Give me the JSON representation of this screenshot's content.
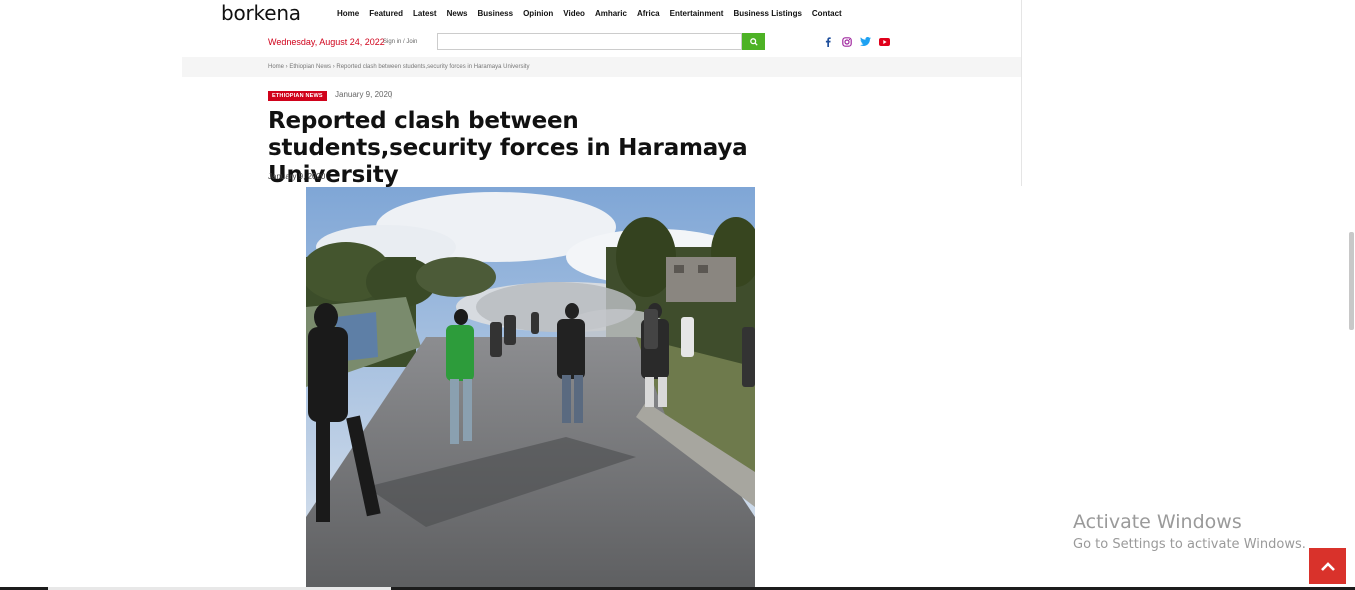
{
  "site": {
    "logo": "borkena"
  },
  "nav": {
    "items": [
      "Home",
      "Featured",
      "Latest",
      "News",
      "Business",
      "Opinion",
      "Video",
      "Amharic",
      "Africa",
      "Entertainment",
      "Business Listings",
      "Contact"
    ]
  },
  "header": {
    "date": "Wednesday, August 24, 2022",
    "signin": "Sign in / Join",
    "search_value": ""
  },
  "social": [
    "facebook-icon",
    "instagram-icon",
    "twitter-icon",
    "youtube-icon"
  ],
  "breadcrumb": "Home › Ethiopian News › Reported clash between students,security forces in Haramaya University",
  "article": {
    "category": "ETHIOPIAN NEWS",
    "meta_date": "January 9, 2020",
    "meta_sep": "|",
    "title": "Reported clash between students,security forces in Haramaya University",
    "date": "January 9, 2020"
  },
  "overlay": {
    "activate_title": "Activate Windows",
    "activate_sub": "Go to Settings to activate Windows."
  },
  "colors": {
    "accent": "#d0021b",
    "search_button": "#4db225",
    "back_to_top": "#d9322b"
  }
}
